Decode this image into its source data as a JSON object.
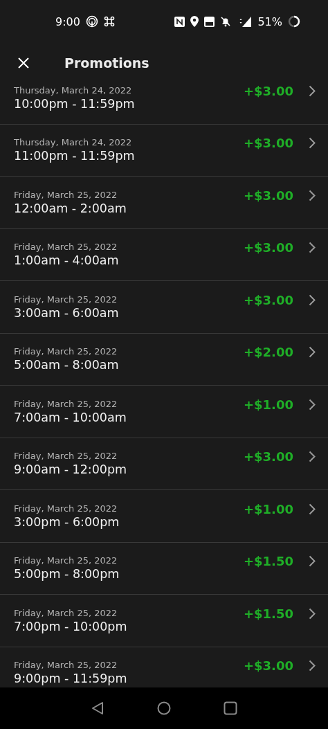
{
  "status_bar": {
    "time": "9:00",
    "battery": "51%"
  },
  "header": {
    "title": "Promotions"
  },
  "promotions": [
    {
      "date": "Thursday, March 24, 2022",
      "hours": "10:00pm - 11:59pm",
      "amount": "+$3.00"
    },
    {
      "date": "Thursday, March 24, 2022",
      "hours": "11:00pm - 11:59pm",
      "amount": "+$3.00"
    },
    {
      "date": "Friday, March 25, 2022",
      "hours": "12:00am - 2:00am",
      "amount": "+$3.00"
    },
    {
      "date": "Friday, March 25, 2022",
      "hours": "1:00am - 4:00am",
      "amount": "+$3.00"
    },
    {
      "date": "Friday, March 25, 2022",
      "hours": "3:00am - 6:00am",
      "amount": "+$3.00"
    },
    {
      "date": "Friday, March 25, 2022",
      "hours": "5:00am - 8:00am",
      "amount": "+$2.00"
    },
    {
      "date": "Friday, March 25, 2022",
      "hours": "7:00am - 10:00am",
      "amount": "+$1.00"
    },
    {
      "date": "Friday, March 25, 2022",
      "hours": "9:00am - 12:00pm",
      "amount": "+$3.00"
    },
    {
      "date": "Friday, March 25, 2022",
      "hours": "3:00pm - 6:00pm",
      "amount": "+$1.00"
    },
    {
      "date": "Friday, March 25, 2022",
      "hours": "5:00pm - 8:00pm",
      "amount": "+$1.50"
    },
    {
      "date": "Friday, March 25, 2022",
      "hours": "7:00pm - 10:00pm",
      "amount": "+$1.50"
    },
    {
      "date": "Friday, March 25, 2022",
      "hours": "9:00pm - 11:59pm",
      "amount": "+$3.00"
    }
  ]
}
